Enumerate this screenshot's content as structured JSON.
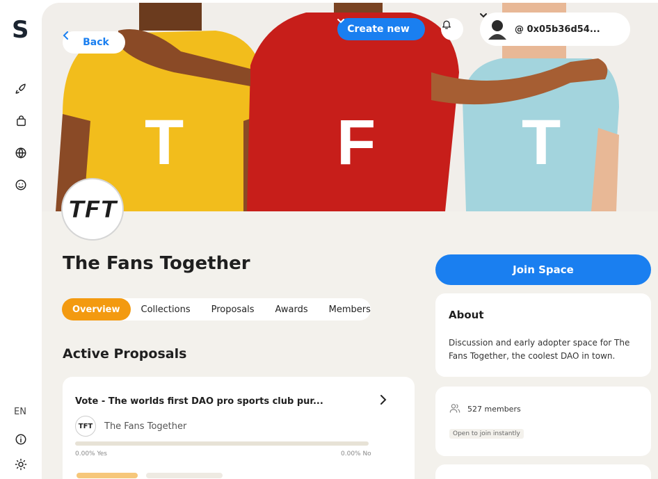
{
  "app": {
    "logo": "S",
    "language": "EN"
  },
  "header": {
    "back_label": "Back",
    "create_label": "Create new",
    "user_handle": "@ 0x05b36d54..."
  },
  "space": {
    "name": "The Fans Together",
    "logo_text": "TFT",
    "banner_letters": [
      "T",
      "F",
      "T"
    ]
  },
  "tabs": [
    {
      "label": "Overview",
      "active": true
    },
    {
      "label": "Collections",
      "active": false
    },
    {
      "label": "Proposals",
      "active": false
    },
    {
      "label": "Awards",
      "active": false
    },
    {
      "label": "Members",
      "active": false
    }
  ],
  "proposals": {
    "section_title": "Active Proposals",
    "items": [
      {
        "title": "Vote - The worlds first DAO pro sports club pur...",
        "space_name": "The Fans Together",
        "yes_label": "0.00% Yes",
        "no_label": "0.00% No",
        "yes_fraction": 0
      }
    ]
  },
  "sidebar_right": {
    "join_label": "Join Space",
    "about_title": "About",
    "about_text": "Discussion and early adopter space for The Fans Together, the coolest DAO in town.",
    "members_count": "527 members",
    "join_note": "Open to join instantly"
  },
  "colors": {
    "accent_blue": "#1a7ff0",
    "accent_orange": "#f39a10",
    "background": "#f3f1ec",
    "shirt_yellow": "#f2bd1c",
    "shirt_red": "#c71e1a",
    "shirt_light_blue": "#a3d4dd"
  },
  "icons": {
    "rail": [
      "rocket-icon",
      "bag-icon",
      "globe-icon",
      "smiley-icon",
      "info-icon",
      "sun-icon"
    ],
    "header": [
      "chevron-left-icon",
      "chevron-down-icon",
      "bell-icon",
      "user-avatar"
    ]
  }
}
